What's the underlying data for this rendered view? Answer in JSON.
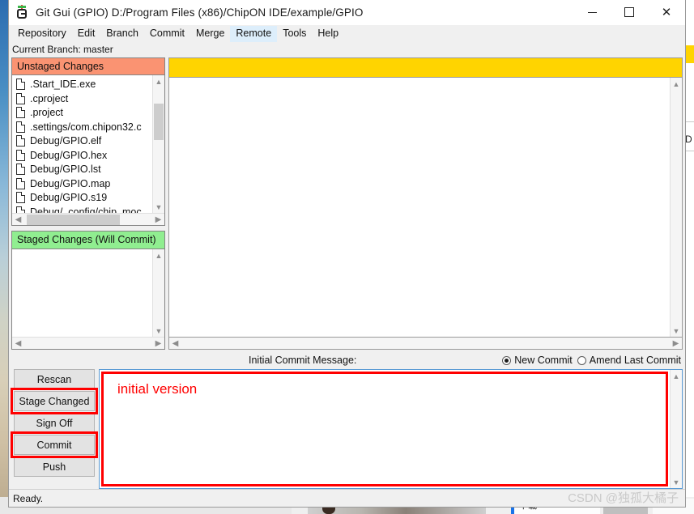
{
  "window": {
    "title": "Git Gui (GPIO) D:/Program Files (x86)/ChipON IDE/example/GPIO",
    "icon": "git-gui-icon",
    "controls": {
      "minimize": "—",
      "maximize": "□",
      "close": "✕"
    }
  },
  "menu": {
    "items": [
      {
        "label": "Repository",
        "active": false
      },
      {
        "label": "Edit",
        "active": false
      },
      {
        "label": "Branch",
        "active": false
      },
      {
        "label": "Commit",
        "active": false
      },
      {
        "label": "Merge",
        "active": false
      },
      {
        "label": "Remote",
        "active": true
      },
      {
        "label": "Tools",
        "active": false
      },
      {
        "label": "Help",
        "active": false
      }
    ]
  },
  "branch_bar": {
    "text": "Current Branch: master"
  },
  "unstaged": {
    "header": "Unstaged Changes",
    "header_color": "#fa9372",
    "files": [
      ".Start_IDE.exe",
      ".cproject",
      ".project",
      ".settings/com.chipon32.c",
      "Debug/GPIO.elf",
      "Debug/GPIO.hex",
      "Debug/GPIO.lst",
      "Debug/GPIO.map",
      "Debug/GPIO.s19",
      "Debug/_config/chip_moc"
    ]
  },
  "staged": {
    "header": "Staged Changes (Will Commit)",
    "header_color": "#90ee90",
    "files": []
  },
  "diff": {
    "banner_color": "#ffd400",
    "banner_text": "",
    "content": ""
  },
  "commit": {
    "message_label": "Initial Commit Message:",
    "message_value": "initial version",
    "message_color": "#ff0000",
    "radios": [
      {
        "label": "New Commit",
        "checked": true
      },
      {
        "label": "Amend Last Commit",
        "checked": false
      }
    ],
    "buttons": [
      {
        "label": "Rescan",
        "highlighted": false
      },
      {
        "label": "Stage Changed",
        "highlighted": true
      },
      {
        "label": "Sign Off",
        "highlighted": false
      },
      {
        "label": "Commit",
        "highlighted": true
      },
      {
        "label": "Push",
        "highlighted": false
      }
    ],
    "annotation_color": "#ff0000"
  },
  "status_bar": {
    "text": "Ready."
  },
  "watermark": {
    "text": "CSDN @独孤大橘子"
  },
  "background": {
    "taskbar_item": "下载"
  }
}
